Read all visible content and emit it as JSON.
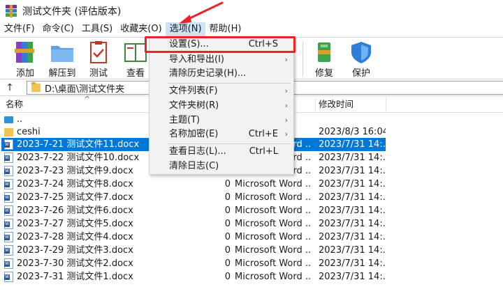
{
  "window": {
    "title": "测试文件夹 (评估版本)"
  },
  "menubar": [
    {
      "label": "文件(F)"
    },
    {
      "label": "命令(C)"
    },
    {
      "label": "工具(S)"
    },
    {
      "label": "收藏夹(O)"
    },
    {
      "label": "选项(N)"
    },
    {
      "label": "帮助(H)"
    }
  ],
  "toolbar": [
    {
      "label": "添加",
      "icon": "rar-books-icon"
    },
    {
      "label": "解压到",
      "icon": "folder-extract-icon"
    },
    {
      "label": "测试",
      "icon": "clipboard-check-icon"
    },
    {
      "label": "查看",
      "icon": "book-view-icon"
    },
    {
      "label": "修复",
      "icon": "repair-kit-icon"
    },
    {
      "label": "保护",
      "icon": "shield-icon"
    }
  ],
  "address": {
    "path": "D:\\桌面\\测试文件夹"
  },
  "columns": {
    "name": "名称",
    "modified": "修改时间"
  },
  "rows": [
    {
      "name": "..",
      "size": "",
      "type": "",
      "modified": "",
      "icon": "up-folder-icon"
    },
    {
      "name": "ceshi",
      "size": "",
      "type": "",
      "modified": "2023/8/3 16:04",
      "icon": "folder-icon"
    },
    {
      "name": "2023-7-21 测试文件11.docx",
      "size": "",
      "type": "Microsoft Word ...",
      "modified": "2023/7/31 14:...",
      "icon": "word-doc-icon",
      "selected": true
    },
    {
      "name": "2023-7-22 测试文件10.docx",
      "size": "",
      "type": "Microsoft Word ...",
      "modified": "2023/7/31 14:...",
      "icon": "word-doc-icon"
    },
    {
      "name": "2023-7-23 测试文件9.docx",
      "size": "",
      "type": "Microsoft Word ...",
      "modified": "2023/7/31 14:...",
      "icon": "word-doc-icon"
    },
    {
      "name": "2023-7-24 测试文件8.docx",
      "size": "0",
      "type": "Microsoft Word ...",
      "modified": "2023/7/31 14:...",
      "icon": "word-doc-icon"
    },
    {
      "name": "2023-7-25 测试文件7.docx",
      "size": "0",
      "type": "Microsoft Word ...",
      "modified": "2023/7/31 14:...",
      "icon": "word-doc-icon"
    },
    {
      "name": "2023-7-26 测试文件6.docx",
      "size": "0",
      "type": "Microsoft Word ...",
      "modified": "2023/7/31 14:...",
      "icon": "word-doc-icon"
    },
    {
      "name": "2023-7-27 测试文件5.docx",
      "size": "0",
      "type": "Microsoft Word ...",
      "modified": "2023/7/31 14:...",
      "icon": "word-doc-icon"
    },
    {
      "name": "2023-7-28 测试文件4.docx",
      "size": "0",
      "type": "Microsoft Word ...",
      "modified": "2023/7/31 14:...",
      "icon": "word-doc-icon"
    },
    {
      "name": "2023-7-29 测试文件3.docx",
      "size": "0",
      "type": "Microsoft Word ...",
      "modified": "2023/7/31 14:...",
      "icon": "word-doc-icon"
    },
    {
      "name": "2023-7-30 测试文件2.docx",
      "size": "0",
      "type": "Microsoft Word ...",
      "modified": "2023/7/31 14:...",
      "icon": "word-doc-icon"
    },
    {
      "name": "2023-7-31 测试文件1.docx",
      "size": "0",
      "type": "Microsoft Word ...",
      "modified": "2023/7/31 14:...",
      "icon": "word-doc-icon"
    }
  ],
  "options_menu": {
    "items": [
      {
        "label": "设置(S)...",
        "shortcut": "Ctrl+S"
      },
      {
        "label": "导入和导出(I)",
        "submenu": true
      },
      {
        "label": "清除历史记录(H)..."
      },
      {
        "label": "文件列表(F)",
        "submenu": true
      },
      {
        "label": "文件夹树(R)",
        "submenu": true
      },
      {
        "label": "主题(T)",
        "submenu": true
      },
      {
        "label": "名称加密(E)",
        "shortcut": "Ctrl+E",
        "submenu": true
      },
      {
        "label": "查看日志(L)...",
        "shortcut": "Ctrl+L"
      },
      {
        "label": "清除日志(C)"
      }
    ],
    "submenu_glyph": "›"
  },
  "colors": {
    "selection": "#0078d7",
    "menu_active": "#cce4f7",
    "annotation": "#e8232a"
  }
}
